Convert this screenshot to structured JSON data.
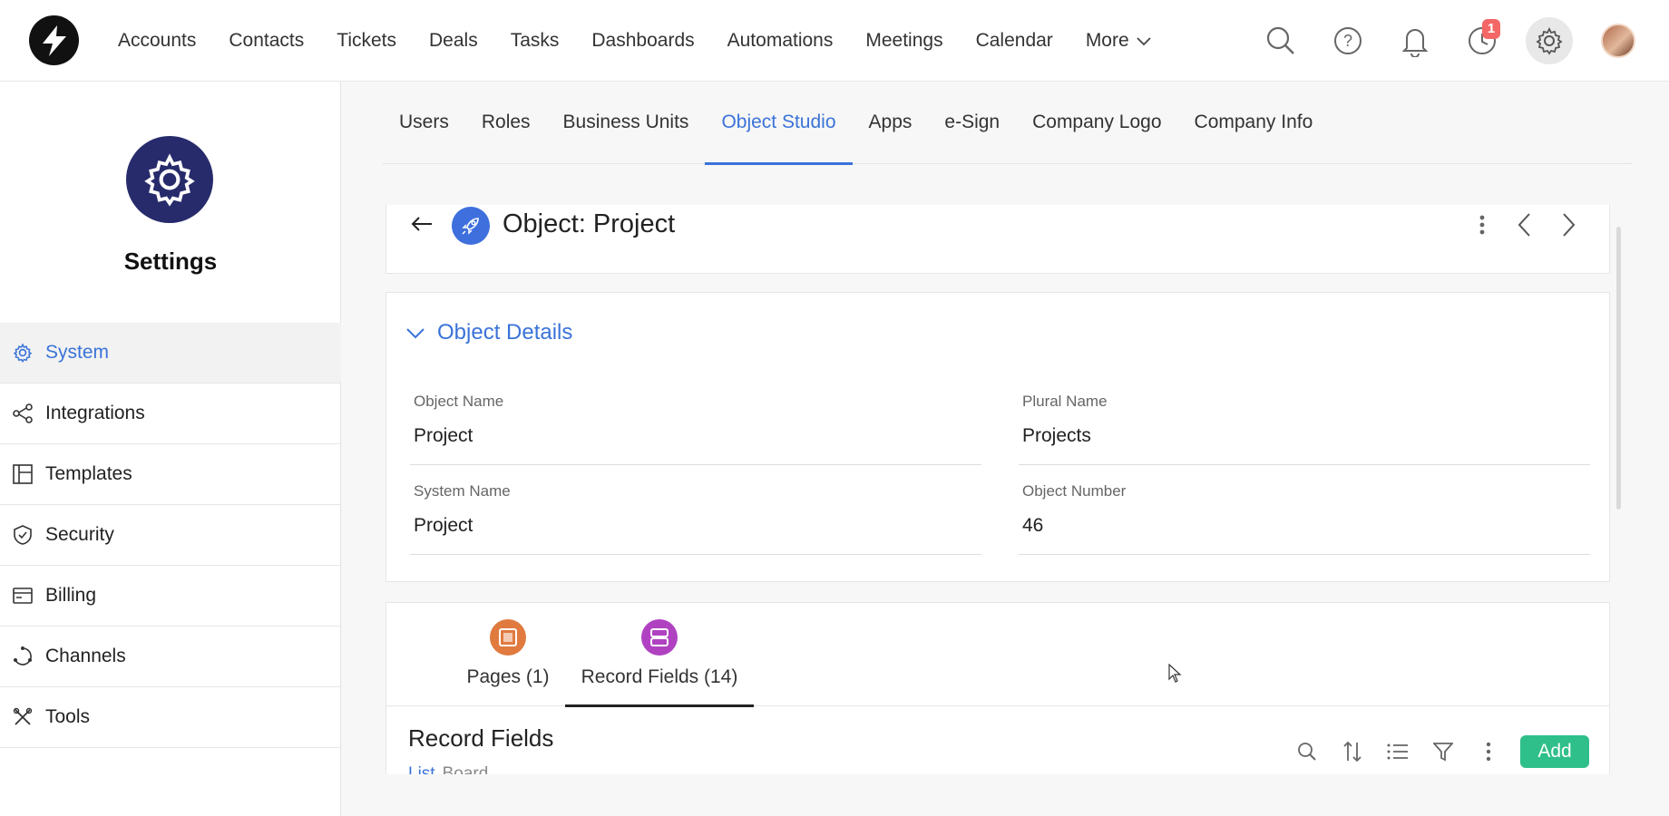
{
  "nav": {
    "items": [
      "Accounts",
      "Contacts",
      "Tickets",
      "Deals",
      "Tasks",
      "Dashboards",
      "Automations",
      "Meetings",
      "Calendar"
    ],
    "more_label": "More"
  },
  "top_icons": {
    "reminder_badge": "1"
  },
  "sidebar": {
    "title": "Settings",
    "items": [
      {
        "label": "System",
        "icon": "gear-icon"
      },
      {
        "label": "Integrations",
        "icon": "share-icon"
      },
      {
        "label": "Templates",
        "icon": "layout-icon"
      },
      {
        "label": "Security",
        "icon": "shield-icon"
      },
      {
        "label": "Billing",
        "icon": "card-icon"
      },
      {
        "label": "Channels",
        "icon": "channels-icon"
      },
      {
        "label": "Tools",
        "icon": "tools-icon"
      }
    ],
    "active_index": 0
  },
  "tabs": {
    "items": [
      "Users",
      "Roles",
      "Business Units",
      "Object Studio",
      "Apps",
      "e-Sign",
      "Company Logo",
      "Company Info"
    ],
    "active_index": 3
  },
  "object": {
    "title": "Object: Project"
  },
  "details": {
    "heading": "Object Details",
    "fields": {
      "object_name_label": "Object Name",
      "object_name_value": "Project",
      "plural_name_label": "Plural Name",
      "plural_name_value": "Projects",
      "system_name_label": "System Name",
      "system_name_value": "Project",
      "object_number_label": "Object Number",
      "object_number_value": "46"
    }
  },
  "lower": {
    "tabs": [
      {
        "label": "Pages (1)",
        "color": "#e07a3f"
      },
      {
        "label": "Record Fields (14)",
        "color": "#b042c2"
      }
    ],
    "active_index": 1,
    "section_title": "Record Fields",
    "sub_link": "List",
    "sub_text": "Board",
    "add_label": "Add"
  },
  "colors": {
    "accent": "#3a73d9",
    "add_button": "#2fbf8a",
    "settings_circle": "#272b6b",
    "badge": "#f36767"
  }
}
